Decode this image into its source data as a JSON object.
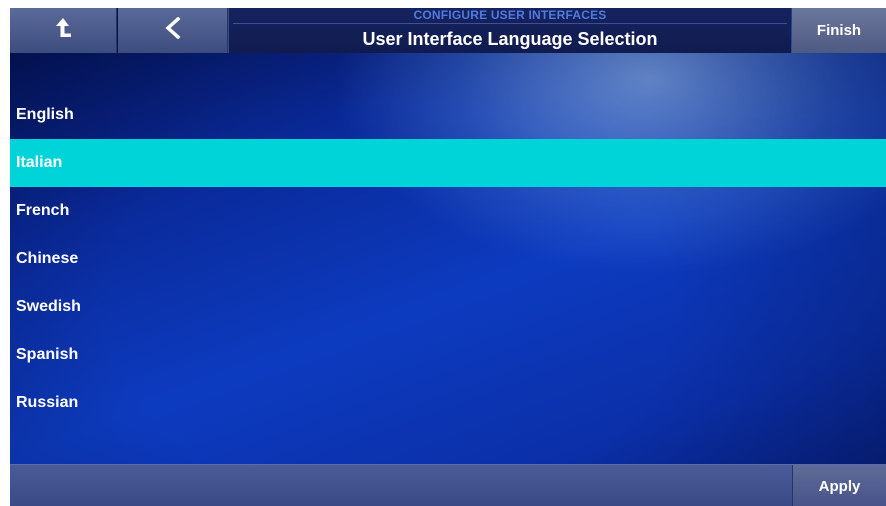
{
  "header": {
    "subtitle": "CONFIGURE USER INTERFACES",
    "title": "User Interface Language Selection",
    "up_icon": "up-arrow-icon",
    "back_icon": "chevron-left-icon",
    "finish_label": "Finish"
  },
  "languages": [
    {
      "label": "English",
      "selected": false
    },
    {
      "label": "Italian",
      "selected": true
    },
    {
      "label": "French",
      "selected": false
    },
    {
      "label": "Chinese",
      "selected": false
    },
    {
      "label": "Swedish",
      "selected": false
    },
    {
      "label": "Spanish",
      "selected": false
    },
    {
      "label": "Russian",
      "selected": false
    }
  ],
  "footer": {
    "apply_label": "Apply"
  },
  "colors": {
    "selected_row": "#00d4d8",
    "subtitle": "#4f7be0",
    "text": "#ffffff"
  }
}
